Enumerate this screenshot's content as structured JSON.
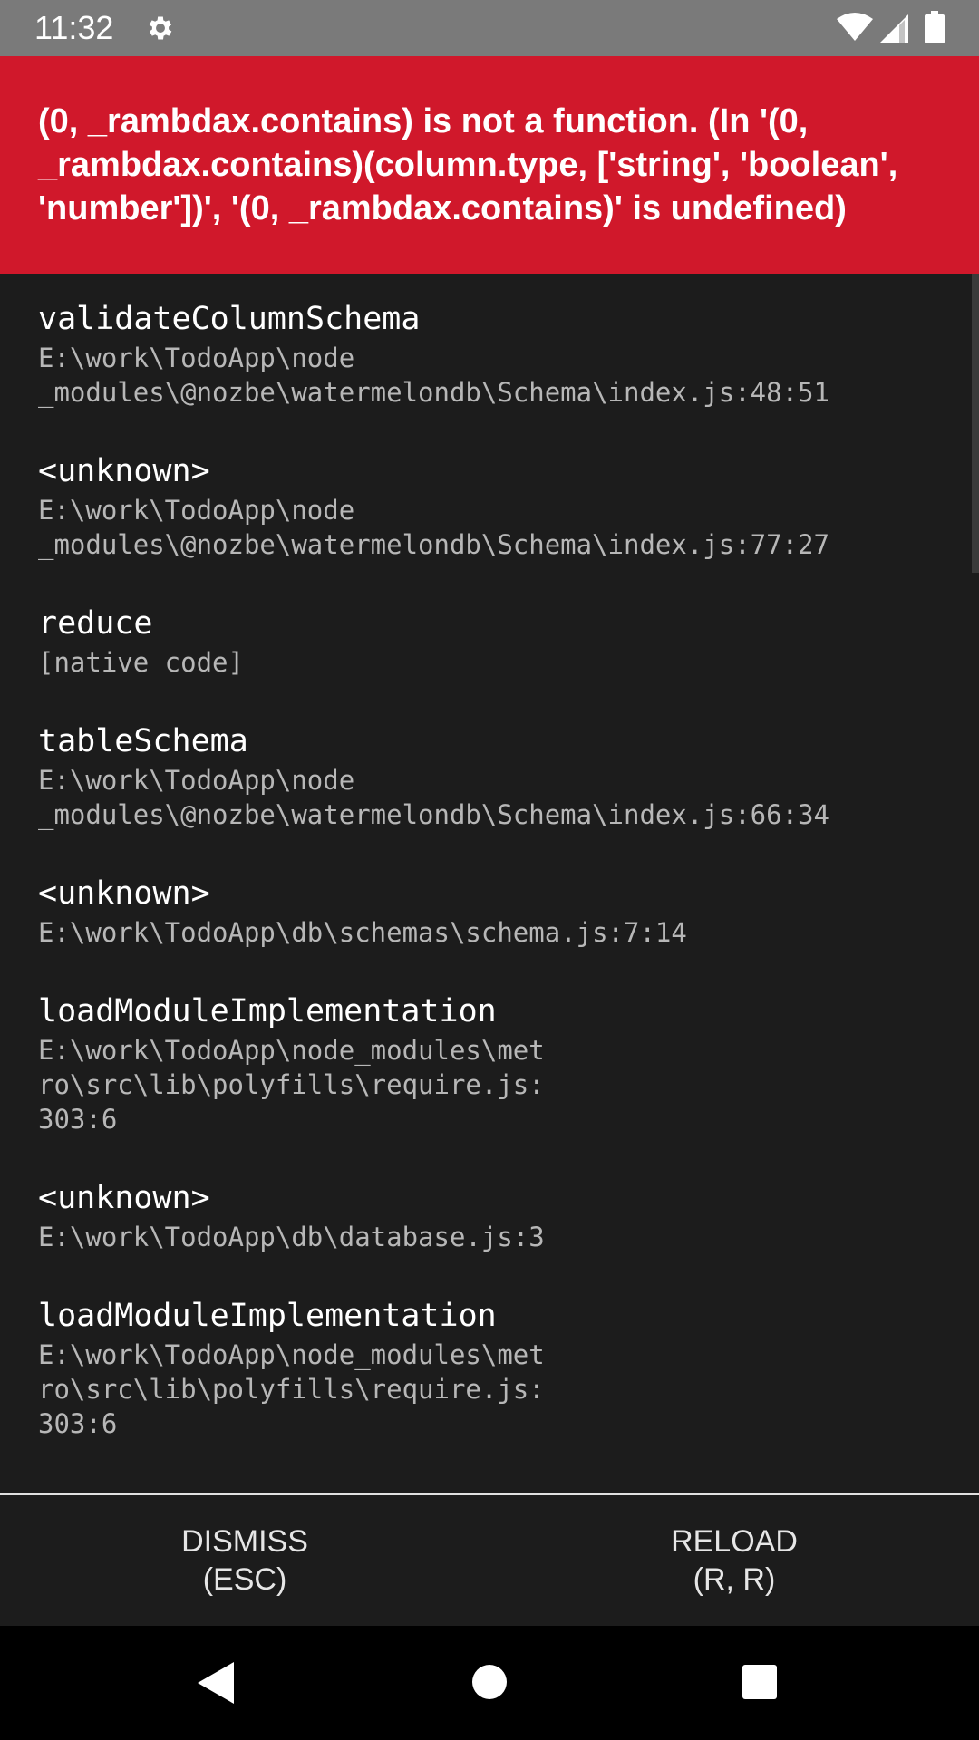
{
  "status_bar": {
    "time": "11:32",
    "icons": [
      "gear-icon",
      "wifi-icon",
      "signal-icon",
      "battery-icon"
    ]
  },
  "error": {
    "message": "(0, _rambdax.contains) is not a function. (In '(0, _rambdax.contains)(column.type, ['string', 'boolean', 'number'])', '(0, _rambdax.contains)' is undefined)",
    "background_color": "#d0182b"
  },
  "stack": [
    {
      "method": "validateColumnSchema",
      "file": "E:\\work\\TodoApp\\node\n_modules\\@nozbe\\watermelondb\\Schema\\index.js:48:51"
    },
    {
      "method": "<unknown>",
      "file": "E:\\work\\TodoApp\\node\n_modules\\@nozbe\\watermelondb\\Schema\\index.js:77:27"
    },
    {
      "method": "reduce",
      "file": "[native code]"
    },
    {
      "method": "tableSchema",
      "file": "E:\\work\\TodoApp\\node\n_modules\\@nozbe\\watermelondb\\Schema\\index.js:66:34"
    },
    {
      "method": "<unknown>",
      "file": "E:\\work\\TodoApp\\db\\schemas\\schema.js:7:14"
    },
    {
      "method": "loadModuleImplementation",
      "file": "E:\\work\\TodoApp\\node_modules\\met\nro\\src\\lib\\polyfills\\require.js:\n303:6"
    },
    {
      "method": "<unknown>",
      "file": "E:\\work\\TodoApp\\db\\database.js:3"
    },
    {
      "method": "loadModuleImplementation",
      "file": "E:\\work\\TodoApp\\node_modules\\met\nro\\src\\lib\\polyfills\\require.js:\n303:6"
    }
  ],
  "actions": {
    "dismiss_label": "DISMISS\n(ESC)",
    "reload_label": "RELOAD\n(R, R)"
  },
  "nav": {
    "icons": [
      "back-icon",
      "home-icon",
      "recent-apps-icon"
    ]
  }
}
